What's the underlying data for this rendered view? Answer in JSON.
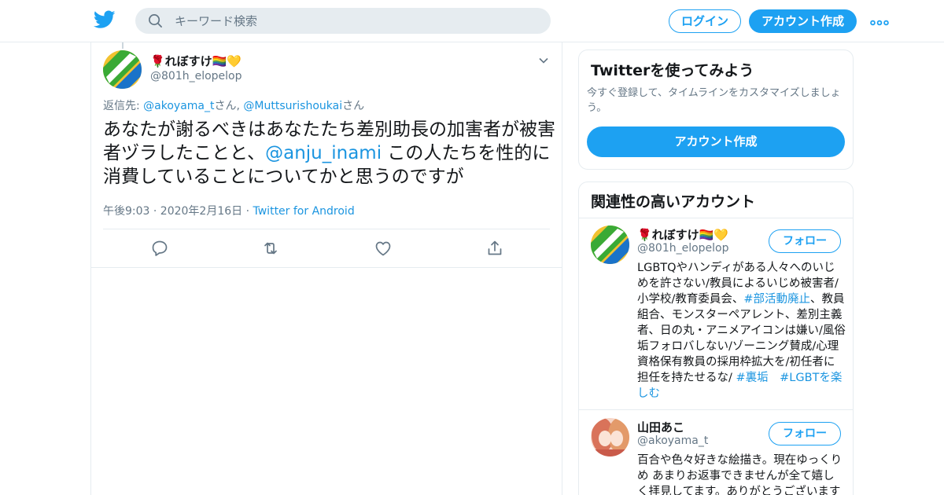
{
  "topbar": {
    "logo_icon": "twitter-bird-icon",
    "search_placeholder": "キーワード検索",
    "login_label": "ログイン",
    "signup_label": "アカウント作成",
    "more_icon": "more-dots-icon",
    "brand_color": "#1da1f2"
  },
  "tweet": {
    "display_name": "🌹れぼすけ🏳️‍🌈💛",
    "handle": "@801h_elopelop",
    "reply_prefix": "返信先: ",
    "reply_user_1": "@akoyama_t",
    "reply_suffix_1": "さん, ",
    "reply_user_2": "@Muttsurishoukai",
    "reply_suffix_2": "さん",
    "text_before": "あなたが謝るべきはあなたたち差別助長の加害者が被害者ヅラしたことと、",
    "mention": "@anju_inami",
    "text_after": " この人たちを性的に消費していることについてかと思うのですが",
    "timestamp": "午後9:03 · 2020年2月16日",
    "meta_separator": " · ",
    "source": "Twitter for Android",
    "actions": [
      "reply-icon",
      "retweet-icon",
      "like-icon",
      "share-icon"
    ]
  },
  "sidebar": {
    "signup_card": {
      "title": "Twitterを使ってみよう",
      "description": "今すぐ登録して、タイムラインをカスタマイズしましょう。",
      "button_label": "アカウント作成"
    },
    "related": {
      "title": "関連性の高いアカウント",
      "follow_label": "フォロー",
      "accounts": [
        {
          "name": "🌹れぼすけ🏳️‍🌈💛",
          "handle": "@801h_elopelop",
          "bio_text": "LGBTQやハンディがある人々へのいじめを許さない/教員によるいじめ被害者/小学校/教育委員会、",
          "bio_tag_1": "#部活動廃止",
          "bio_text_2": "、教員組合、モンスターペアレント、差別主義者、日の丸・アニメアイコンは嫌い/風俗垢フォロバしない/ゾーニング賛成/心理資格保有教員の採用枠拡大を/初任者に担任を持たせるな/ ",
          "bio_tag_2": "#裏垢",
          "bio_sep": "　",
          "bio_tag_3": "#LGBTを楽しむ"
        },
        {
          "name": "山田あこ",
          "handle": "@akoyama_t",
          "bio_text": "百合や色々好きな絵描き。現在ゆっくりめ あまりお返事できませんが全て嬉しく拝見してます。ありがとうございます"
        }
      ]
    }
  }
}
